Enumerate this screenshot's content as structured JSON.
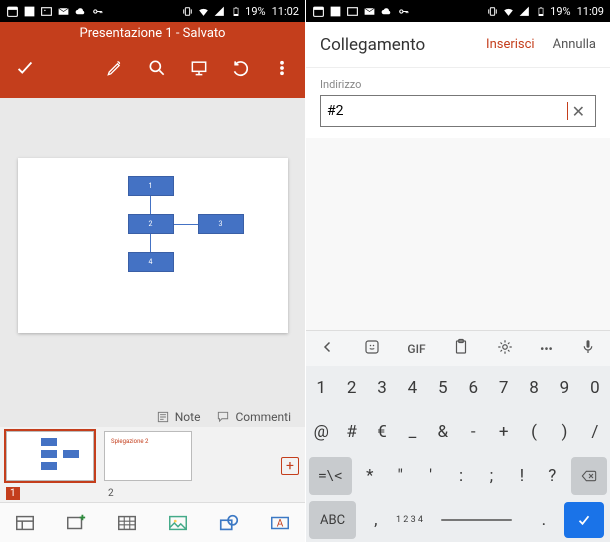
{
  "status": {
    "battery": "19%",
    "time_left": "11:02",
    "time_right": "11:09"
  },
  "pp": {
    "title": "Presentazione 1 - Salvato"
  },
  "notes": {
    "note": "Note",
    "comments": "Commenti"
  },
  "thumbs": {
    "n1": "1",
    "n2": "2"
  },
  "dialog": {
    "title": "Collegamento",
    "insert": "Inserisci",
    "cancel": "Annulla",
    "address_label": "Indirizzo",
    "address_value": "#2"
  },
  "kbdtool": {
    "gif": "GIF"
  },
  "row1": {
    "k1": "1",
    "k2": "2",
    "k3": "3",
    "k4": "4",
    "k5": "5",
    "k6": "6",
    "k7": "7",
    "k8": "8",
    "k9": "9",
    "k0": "0"
  },
  "row2": {
    "k1": "@",
    "k2": "#",
    "k3": "€",
    "k4": "_",
    "k5": "&",
    "k6": "-",
    "k7": "+",
    "k8": "(",
    "k9": ")",
    "k10": "/"
  },
  "row3": {
    "shift": "=\\<",
    "k1": "*",
    "k2": "\"",
    "k3": "'",
    "k4": ":",
    "k5": ";",
    "k6": "!",
    "k7": "?"
  },
  "row4": {
    "abc": "ABC",
    "comma": ",",
    "numstack": "1 2\n3 4",
    "dot": "."
  }
}
